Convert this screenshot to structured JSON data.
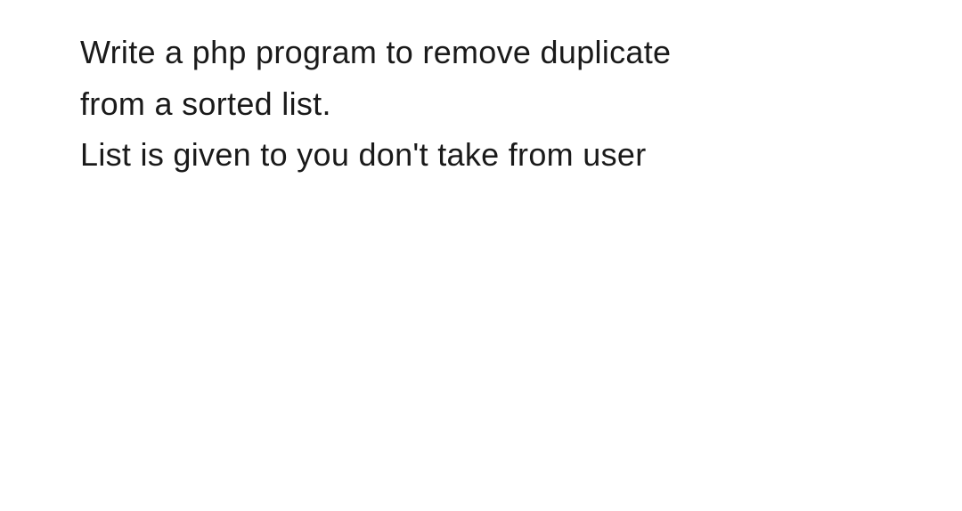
{
  "content": {
    "line1": "Write a php program to remove duplicate",
    "line2": "from a sorted list.",
    "line3": "List is given to you don't take from user"
  }
}
